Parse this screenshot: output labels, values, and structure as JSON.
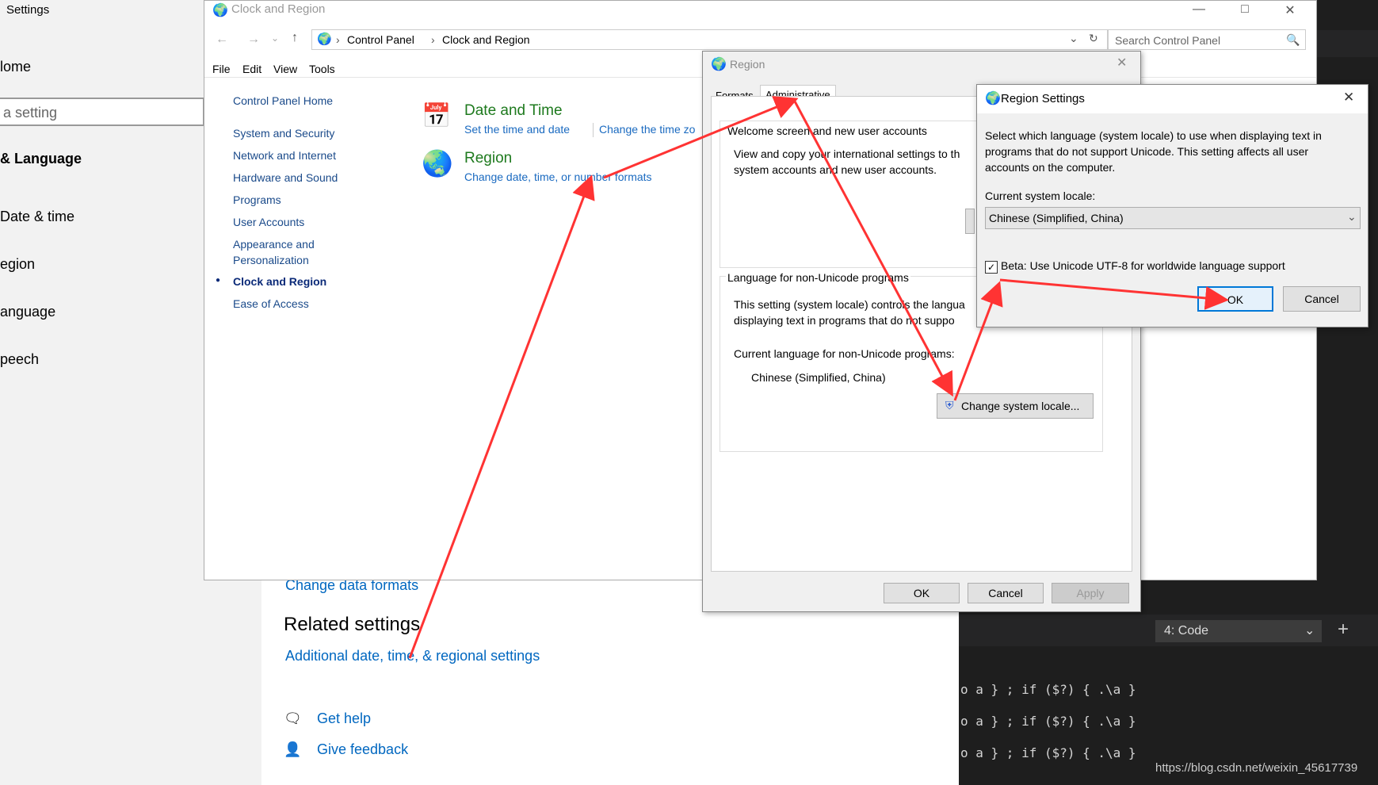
{
  "settings": {
    "title": "Settings",
    "nav": [
      "lome",
      "a setting",
      "& Language",
      "Date & time",
      "egion",
      "anguage",
      "peech"
    ],
    "change_data_formats": "Change data formats",
    "related_settings": "Related settings",
    "additional_settings": "Additional date, time, & regional settings",
    "get_help": "Get help",
    "give_feedback": "Give feedback"
  },
  "control_panel": {
    "title": "Clock and Region",
    "breadcrumb": [
      "Control Panel",
      "Clock and Region"
    ],
    "search_placeholder": "Search Control Panel",
    "menu": [
      "File",
      "Edit",
      "View",
      "Tools"
    ],
    "nav": [
      "Control Panel Home",
      "System and Security",
      "Network and Internet",
      "Hardware and Sound",
      "Programs",
      "User Accounts",
      "Appearance and",
      "Personalization",
      "Clock and Region",
      "Ease of Access"
    ],
    "categories": [
      {
        "title": "Date and Time",
        "links": [
          "Set the time and date",
          "Change the time zo"
        ]
      },
      {
        "title": "Region",
        "links": [
          "Change date, time, or number formats"
        ]
      }
    ]
  },
  "region_dialog": {
    "title": "Region",
    "tabs": [
      "Formats",
      "Administrative"
    ],
    "welcome_group": "Welcome screen and new user accounts",
    "welcome_text_1": "View and copy your international settings to th",
    "welcome_text_2": "system accounts and new user accounts.",
    "nonunicode_group": "Language for non-Unicode programs",
    "nonunicode_text_1": "This setting (system locale) controls the langua",
    "nonunicode_text_2": "displaying text in programs that do not suppo",
    "current_label": "Current language for non-Unicode programs:",
    "current_value": "Chinese (Simplified, China)",
    "change_button": "Change system locale...",
    "ok": "OK",
    "cancel": "Cancel",
    "apply": "Apply"
  },
  "region_settings": {
    "title": "Region Settings",
    "desc_1": "Select which language (system locale) to use when displaying text in",
    "desc_2": "programs that do not support Unicode. This setting affects all user",
    "desc_3": "accounts on the computer.",
    "locale_label": "Current system locale:",
    "locale_value": "Chinese (Simplified, China)",
    "beta_label": "Beta: Use Unicode UTF-8 for worldwide language support",
    "beta_checked": true,
    "ok": "OK",
    "cancel": "Cancel"
  },
  "editor": {
    "terminal_select": "4: Code",
    "code_lines": [
      "o a } ; if ($?) { .\\a }",
      "o a } ; if ($?) { .\\a }",
      "o a } ; if ($?) { .\\a }"
    ]
  },
  "watermark": "https://blog.csdn.net/weixin_45617739",
  "colors": {
    "annotation_arrow": "#ff3333",
    "link": "#0067c0",
    "cp_green": "#1e7a1e"
  }
}
